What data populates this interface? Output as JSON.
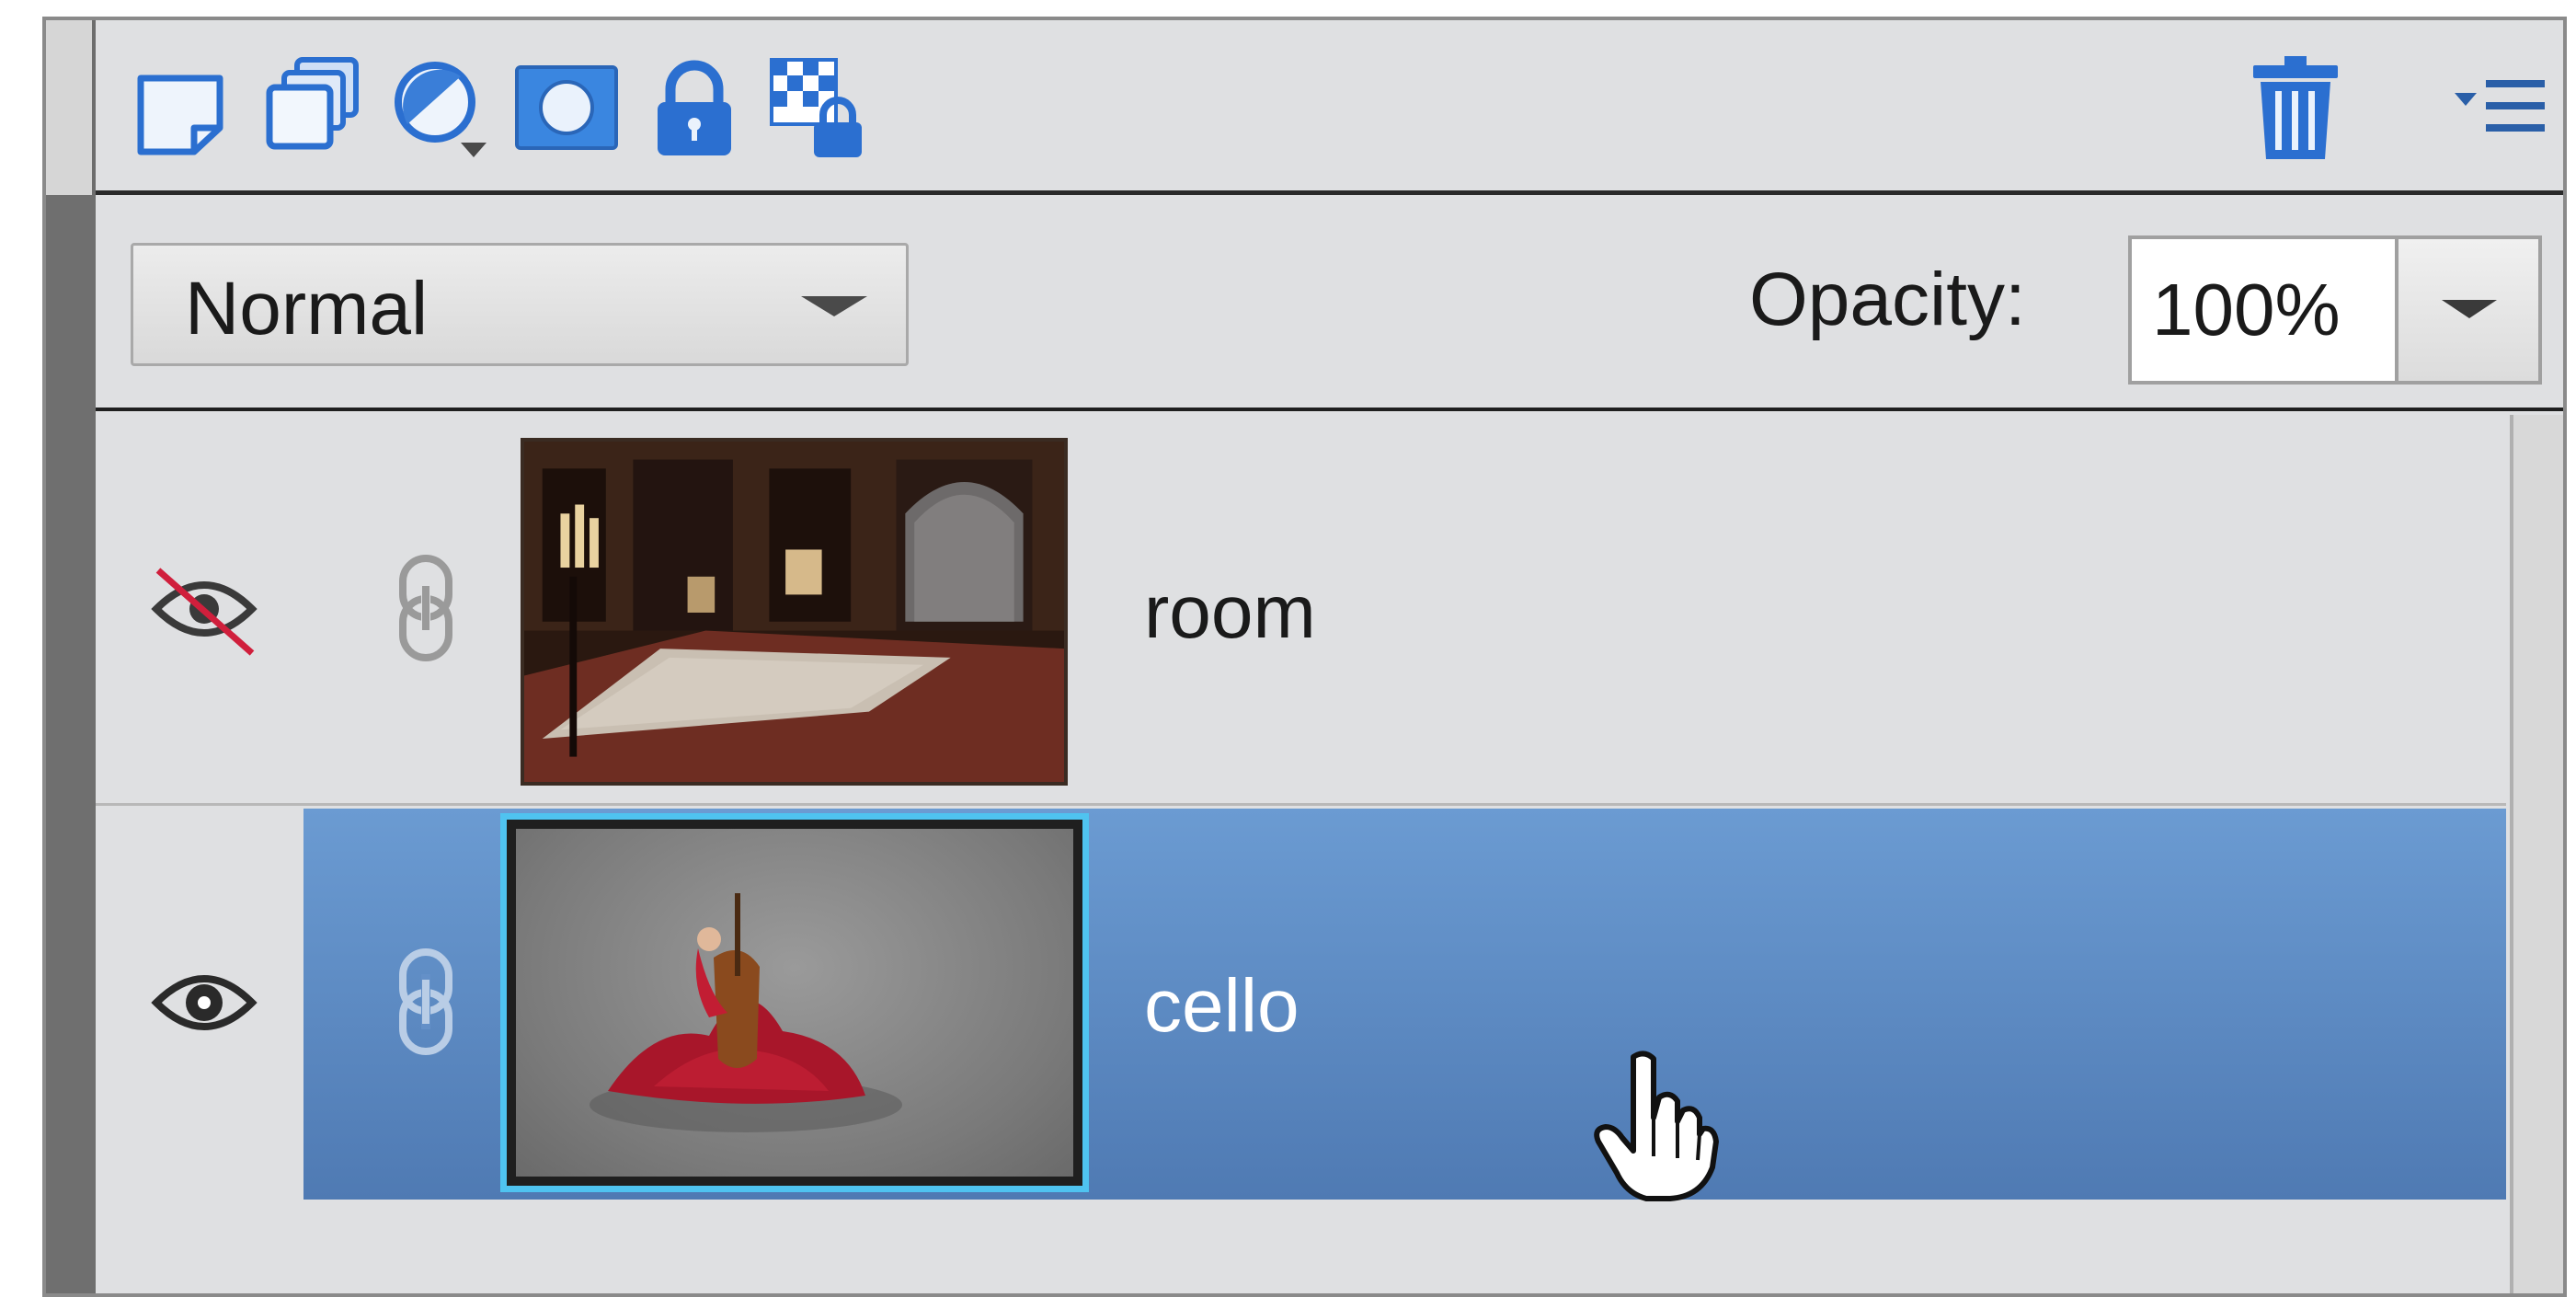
{
  "toolbar": {
    "buttons": [
      {
        "name": "new-layer",
        "icon": "new-layer-icon"
      },
      {
        "name": "new-group",
        "icon": "duplicate-layers-icon"
      },
      {
        "name": "adjustment-layer",
        "icon": "adjustment-layer-icon"
      },
      {
        "name": "layer-mask",
        "icon": "layer-mask-icon"
      },
      {
        "name": "lock-all",
        "icon": "lock-icon"
      },
      {
        "name": "lock-transparency",
        "icon": "lock-transparency-icon"
      },
      {
        "name": "delete-layer",
        "icon": "trash-icon"
      },
      {
        "name": "panel-menu",
        "icon": "panel-menu-icon"
      }
    ]
  },
  "controls": {
    "blend_mode": "Normal",
    "opacity_label": "Opacity:",
    "opacity_value": "100%"
  },
  "layers": [
    {
      "name": "room",
      "visible": false,
      "selected": false
    },
    {
      "name": "cello",
      "visible": true,
      "selected": true
    }
  ],
  "colors": {
    "panel_bg": "#dfe0e2",
    "selection_blue_top": "#6b9bd2",
    "selection_blue_bottom": "#4f7ab3",
    "icon_blue": "#3a7ed8",
    "thumb_highlight": "#4fc3f0"
  }
}
